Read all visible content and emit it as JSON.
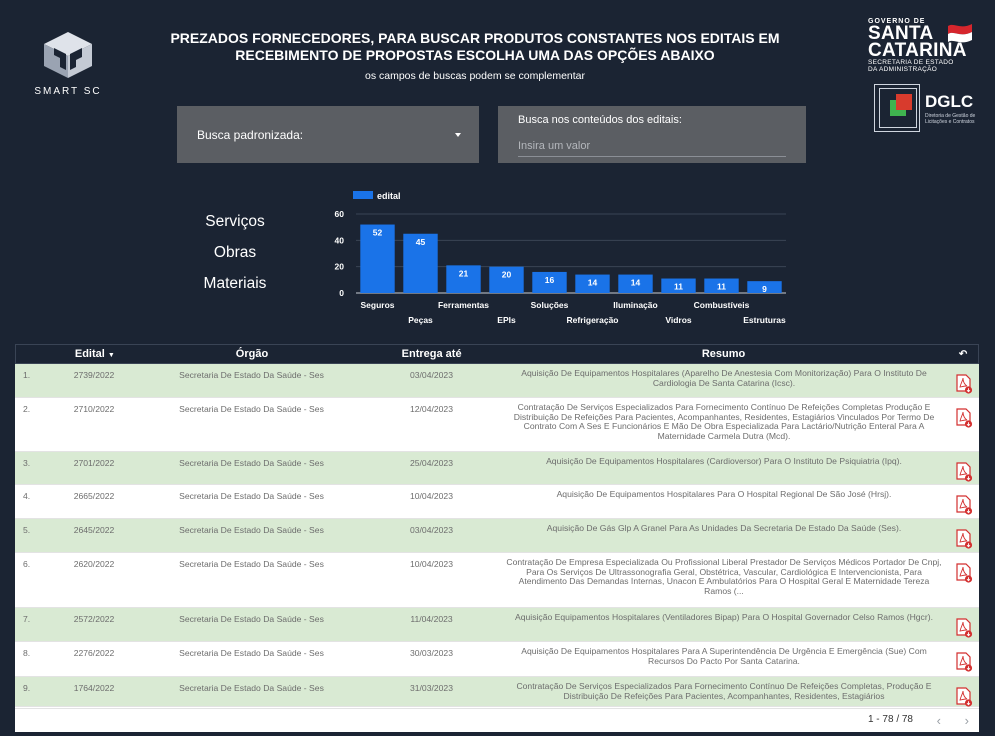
{
  "header": {
    "smart_logo_text": "SMART SC",
    "title": "PREZADOS FORNECEDORES, PARA BUSCAR PRODUTOS CONSTANTES NOS EDITAIS EM RECEBIMENTO DE PROPOSTAS ESCOLHA UMA DAS OPÇÕES ABAIXO",
    "subtitle": "os campos de buscas podem se complementar",
    "sc_logo": {
      "gov": "GOVERNO DE",
      "line1": "SANTA",
      "line2": "CATARINA",
      "sub1": "SECRETARIA DE ESTADO",
      "sub2": "DA ADMINISTRAÇÃO"
    },
    "dglc_logo": {
      "label": "DGLC",
      "sub": "Diretoria de Gestão de Licitações e Contratos"
    }
  },
  "filters": {
    "dropdown_label": "Busca padronizada:",
    "search_label": "Busca nos conteúdos dos editais:",
    "search_placeholder": "Insira um valor"
  },
  "categories": [
    "Serviços",
    "Obras",
    "Materiais"
  ],
  "chart_data": {
    "type": "bar",
    "legend": [
      "edital"
    ],
    "legend_position": "top-left",
    "categories": [
      "Seguros",
      "Peças",
      "Ferramentas",
      "EPIs",
      "Soluções",
      "Refrigeração",
      "Iluminação",
      "Vidros",
      "Combustíveis",
      "Estruturas"
    ],
    "series": [
      {
        "name": "edital",
        "values": [
          52,
          45,
          21,
          20,
          16,
          14,
          14,
          11,
          11,
          9
        ]
      }
    ],
    "ylim": [
      0,
      60
    ],
    "yticks": [
      0,
      20,
      40,
      60
    ],
    "grid": true,
    "bar_color": "#1a73e8",
    "grid_color": "#3a4455"
  },
  "table": {
    "headers": {
      "edital": "Edital",
      "orgao": "Órgão",
      "entrega": "Entrega até",
      "resumo": "Resumo"
    },
    "rows": [
      {
        "n": "1.",
        "edital": "2739/2022",
        "orgao": "Secretaria De Estado Da Saúde - Ses",
        "entrega": "03/04/2023",
        "resumo": "Aquisição De Equipamentos Hospitalares (Aparelho De Anestesia Com Monitorização) Para O Instituto De Cardiologia De Santa Catarina (Icsc)."
      },
      {
        "n": "2.",
        "edital": "2710/2022",
        "orgao": "Secretaria De Estado Da Saúde - Ses",
        "entrega": "12/04/2023",
        "resumo": "Contratação De Serviços Especializados Para Fornecimento Contínuo De Refeições Completas Produção E Distribuição De Refeições Para Pacientes, Acompanhantes, Residentes, Estagiários Vinculados Por Termo De Contrato Com A Ses E Funcionários E Mão De Obra Especializada Para Lactário/Nutrição Enteral Para A Maternidade Carmela Dutra (Mcd)."
      },
      {
        "n": "3.",
        "edital": "2701/2022",
        "orgao": "Secretaria De Estado Da Saúde - Ses",
        "entrega": "25/04/2023",
        "resumo": "Aquisição De Equipamentos Hospitalares (Cardioversor) Para O Instituto De Psiquiatria (Ipq)."
      },
      {
        "n": "4.",
        "edital": "2665/2022",
        "orgao": "Secretaria De Estado Da Saúde - Ses",
        "entrega": "10/04/2023",
        "resumo": "Aquisição De Equipamentos Hospitalares Para O Hospital Regional De São José (Hrsj)."
      },
      {
        "n": "5.",
        "edital": "2645/2022",
        "orgao": "Secretaria De Estado Da Saúde - Ses",
        "entrega": "03/04/2023",
        "resumo": "Aquisição De Gás Glp A Granel Para As Unidades Da Secretaria De Estado Da Saúde (Ses)."
      },
      {
        "n": "6.",
        "edital": "2620/2022",
        "orgao": "Secretaria De Estado Da Saúde - Ses",
        "entrega": "10/04/2023",
        "resumo": "Contratação De Empresa Especializada Ou Profissional Liberal Prestador De Serviços Médicos Portador De Cnpj, Para Os Serviços De Ultrassonografia Geral, Obstétrica, Vascular, Cardiológica E Intervencionista, Para Atendimento Das Demandas Internas, Unacon E Ambulatórios Para O Hospital Geral E Maternidade Tereza Ramos (..."
      },
      {
        "n": "7.",
        "edital": "2572/2022",
        "orgao": "Secretaria De Estado Da Saúde - Ses",
        "entrega": "11/04/2023",
        "resumo": "Aquisição Equipamentos Hospitalares (Ventiladores Bipap) Para O Hospital Governador Celso Ramos (Hgcr)."
      },
      {
        "n": "8.",
        "edital": "2276/2022",
        "orgao": "Secretaria De Estado Da Saúde - Ses",
        "entrega": "30/03/2023",
        "resumo": "Aquisição De Equipamentos Hospitalares Para A Superintendência De Urgência E Emergência (Sue) Com Recursos Do Pacto Por Santa Catarina."
      },
      {
        "n": "9.",
        "edital": "1764/2022",
        "orgao": "Secretaria De Estado Da Saúde - Ses",
        "entrega": "31/03/2023",
        "resumo": "Contratação De Serviços Especializados Para Fornecimento Contínuo De Refeições Completas, Produção E Distribuição De Refeições Para Pacientes, Acompanhantes, Residentes, Estagiários"
      }
    ],
    "pagination": "1 - 78 / 78"
  }
}
